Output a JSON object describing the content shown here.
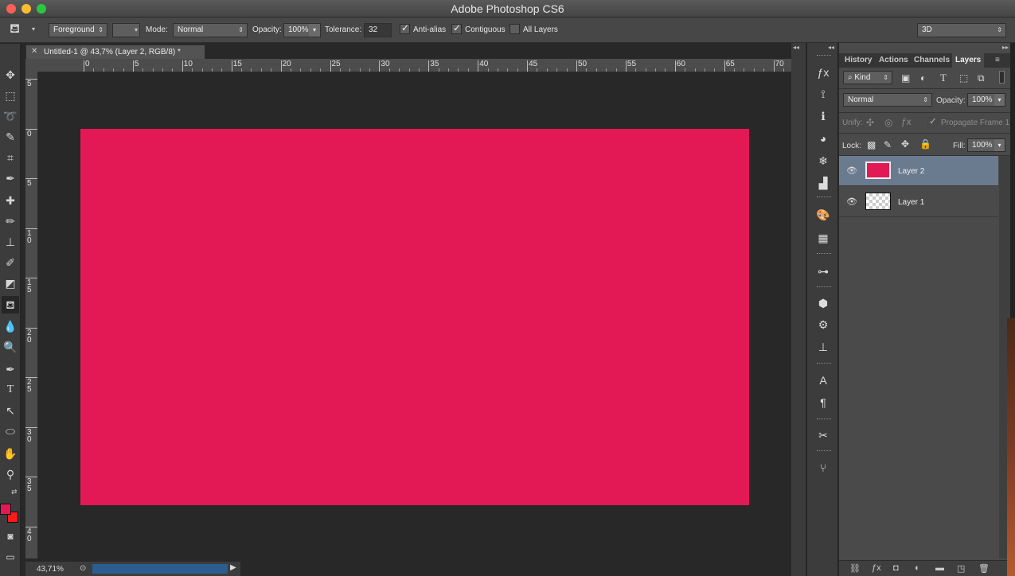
{
  "window": {
    "title": "Adobe Photoshop CS6"
  },
  "options": {
    "fill_source": "Foreground",
    "mode_label": "Mode:",
    "mode_value": "Normal",
    "opacity_label": "Opacity:",
    "opacity_value": "100%",
    "tolerance_label": "Tolerance:",
    "tolerance_value": "32",
    "antialias_label": "Anti-alias",
    "contiguous_label": "Contiguous",
    "all_layers_label": "All Layers",
    "workspace": "3D"
  },
  "document": {
    "tab_title": "Untitled-1 @ 43,7% (Layer 2, RGB/8) *",
    "zoom": "43,71%",
    "artboard_color": "#e31956",
    "ruler_h": [
      "0",
      "5",
      "10",
      "15",
      "20",
      "25",
      "30",
      "35",
      "40",
      "45",
      "50",
      "55",
      "60",
      "65",
      "70"
    ],
    "ruler_v": [
      "5",
      "0",
      "5",
      "1 0",
      "1 5",
      "2 0",
      "2 5",
      "3 0",
      "3 5",
      "4 0"
    ]
  },
  "tools": {
    "foreground_color": "#e31956",
    "background_color": "#ff1a1a"
  },
  "layers_panel": {
    "tabs": [
      "History",
      "Actions",
      "Channels",
      "Layers"
    ],
    "active_tab": "Layers",
    "kind_label": "Kind",
    "blend_mode": "Normal",
    "opacity_label": "Opacity:",
    "opacity_value": "100%",
    "unify_label": "Unify:",
    "propagate_label": "Propagate Frame 1",
    "lock_label": "Lock:",
    "fill_label": "Fill:",
    "fill_value": "100%",
    "layers": [
      {
        "name": "Layer 2",
        "selected": true,
        "thumb": "#e31956"
      },
      {
        "name": "Layer 1",
        "selected": false,
        "thumb": "transparent"
      }
    ]
  }
}
